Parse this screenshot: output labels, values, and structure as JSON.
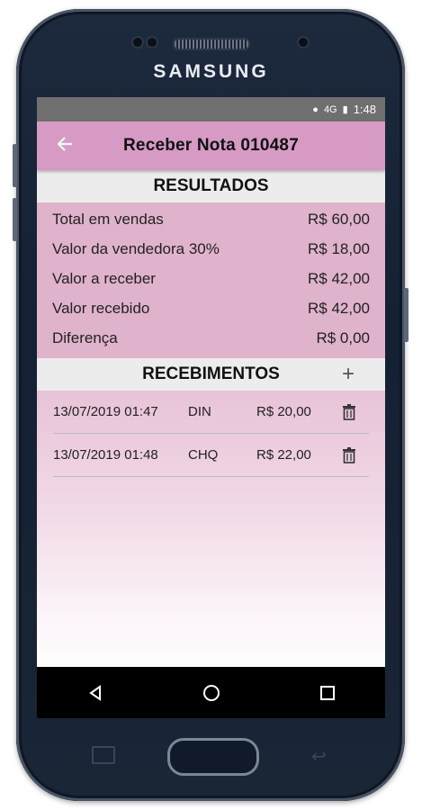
{
  "device": {
    "brand": "SAMSUNG"
  },
  "status_bar": {
    "time": "1:48",
    "network": "4G"
  },
  "app_bar": {
    "title": "Receber Nota 010487",
    "back_icon": "arrow-left-icon"
  },
  "results": {
    "header": "RESULTADOS",
    "rows": [
      {
        "label": "Total em vendas",
        "value": "R$ 60,00"
      },
      {
        "label": "Valor da vendedora 30%",
        "value": "R$ 18,00"
      },
      {
        "label": "Valor a receber",
        "value": "R$ 42,00"
      },
      {
        "label": "Valor recebido",
        "value": "R$ 42,00"
      },
      {
        "label": "Diferença",
        "value": "R$ 0,00"
      }
    ]
  },
  "recebimentos": {
    "header": "RECEBIMENTOS",
    "add_label": "+",
    "items": [
      {
        "datetime": "13/07/2019 01:47",
        "type": "DIN",
        "value": "R$ 20,00"
      },
      {
        "datetime": "13/07/2019 01:48",
        "type": "CHQ",
        "value": "R$ 22,00"
      }
    ]
  },
  "colors": {
    "app_bar": "#d79ac5",
    "results_bg": "#e0b3cc",
    "section_header": "#ececec",
    "status_bar": "#6f6f6f"
  }
}
